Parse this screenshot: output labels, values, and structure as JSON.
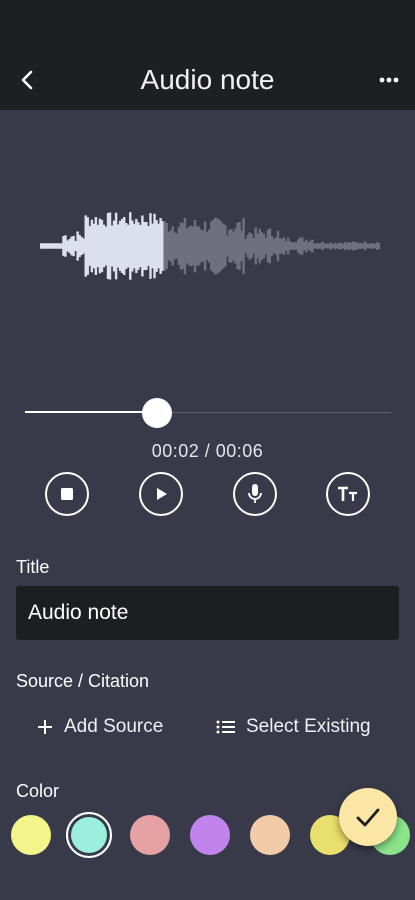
{
  "header": {
    "title": "Audio note",
    "back_icon": "chevron-left-icon",
    "more_icon": "more-horizontal-icon"
  },
  "player": {
    "current_time": "00:02",
    "total_time": "00:06",
    "time_display": "00:02 / 00:06",
    "progress": 0.36,
    "controls": [
      "stop-icon",
      "play-icon",
      "microphone-icon",
      "text-size-icon"
    ]
  },
  "form": {
    "title_label": "Title",
    "title_value": "Audio note",
    "source_label": "Source / Citation",
    "add_source_label": "Add Source",
    "select_existing_label": "Select Existing",
    "color_label": "Color"
  },
  "colors": {
    "background": "#383a4a",
    "bar": "#1e1f22",
    "wave_played": "#dcdfee",
    "wave_unplayed": "#6e707d",
    "fab": "#fbe6a6",
    "swatches": [
      "#f3f58a",
      "#9af0dc",
      "#e6a2a2",
      "#c084ec",
      "#f2cba8",
      "#e9df6c",
      "#8be48a"
    ],
    "selected_swatch_index": 1
  }
}
